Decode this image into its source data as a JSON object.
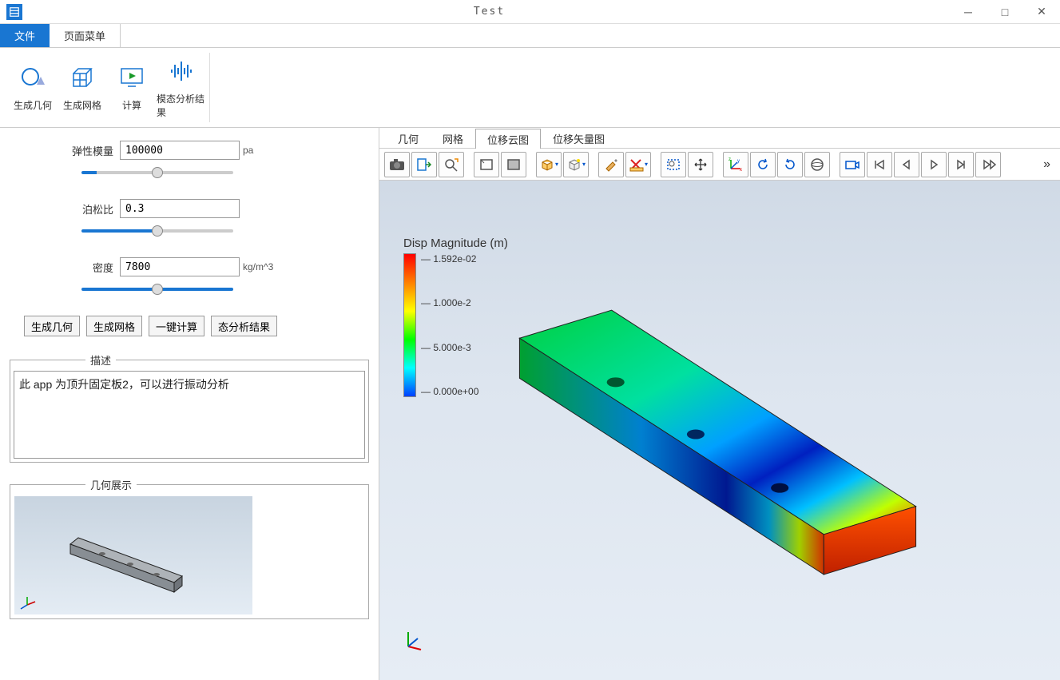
{
  "window": {
    "title": "Test"
  },
  "menu": {
    "tabs": [
      {
        "label": "文件",
        "active": true
      },
      {
        "label": "页面菜单",
        "active": false
      }
    ]
  },
  "ribbon": {
    "items": [
      {
        "id": "gen-geom",
        "label": "生成几何"
      },
      {
        "id": "gen-mesh",
        "label": "生成网格"
      },
      {
        "id": "compute",
        "label": "计算"
      },
      {
        "id": "modal-res",
        "label": "模态分析结果"
      }
    ]
  },
  "params": {
    "elastic_modulus": {
      "label": "弹性模量",
      "value": "100000",
      "unit": "pa",
      "slider_pct": 10
    },
    "poisson_ratio": {
      "label": "泊松比",
      "value": "0.3",
      "unit": "",
      "slider_pct": 50
    },
    "density": {
      "label": "密度",
      "value": "7800",
      "unit": "kg/m^3",
      "slider_pct": 100
    }
  },
  "actions": {
    "gen_geom": "生成几何",
    "gen_mesh": "生成网格",
    "compute": "一键计算",
    "modal": "态分析结果"
  },
  "description": {
    "legend": "描述",
    "text": "此 app 为顶升固定板2，可以进行振动分析"
  },
  "geom_display": {
    "legend": "几何展示"
  },
  "view_tabs": [
    {
      "label": "几何"
    },
    {
      "label": "网格"
    },
    {
      "label": "位移云图",
      "active": true
    },
    {
      "label": "位移矢量图"
    }
  ],
  "legend_data": {
    "title": "Disp Magnitude (m)",
    "ticks": [
      "1.592e-02",
      "1.000e-2",
      "5.000e-3",
      "0.000e+00"
    ]
  },
  "toolbar_icons": [
    "camera-icon",
    "export-icon",
    "zoom-fit-icon",
    "select-box-icon",
    "select-face-icon",
    "view-cube-icon",
    "iso-cube-icon",
    "clean-brush-icon",
    "ruler-x-icon",
    "dashed-box-icon",
    "move-icon",
    "axes-icon",
    "rotate-ccw-icon",
    "rotate-cw-icon",
    "sphere-icon",
    "record-icon",
    "first-frame-icon",
    "prev-frame-icon",
    "play-icon",
    "next-frame-icon",
    "last-frame-icon"
  ]
}
